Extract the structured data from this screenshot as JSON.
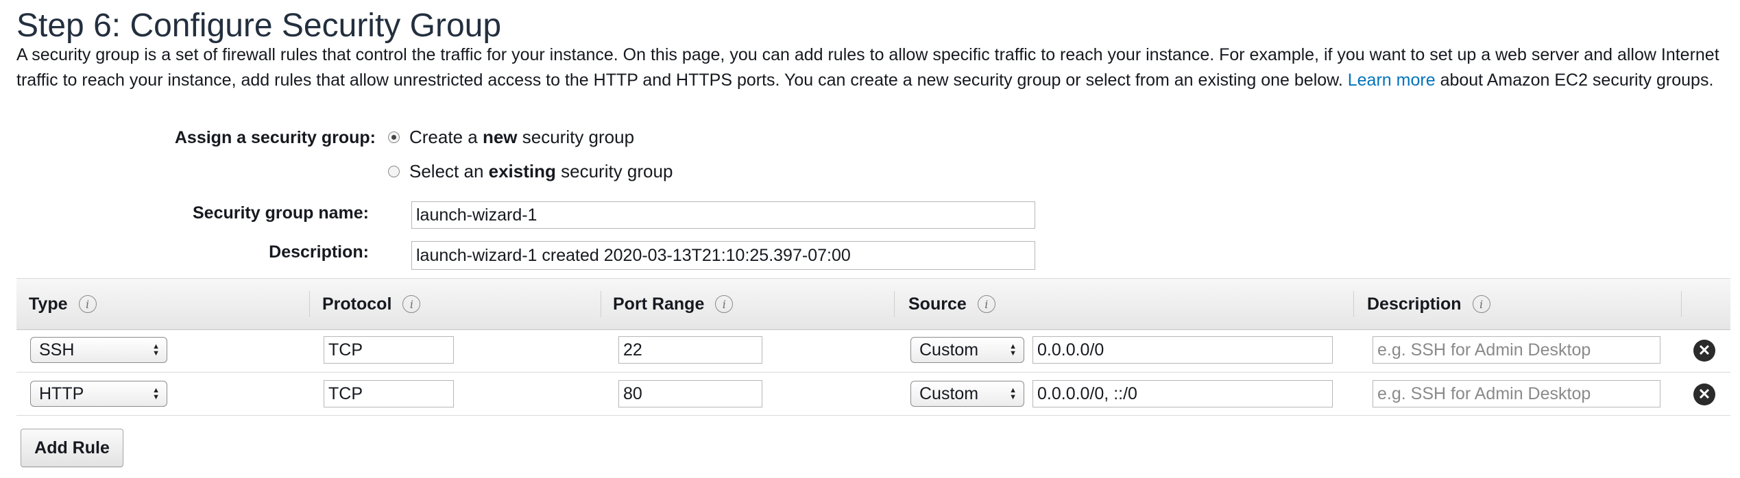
{
  "page": {
    "title": "Step 6: Configure Security Group",
    "intro_text": "A security group is a set of firewall rules that control the traffic for your instance. On this page, you can add rules to allow specific traffic to reach your instance. For example, if you want to set up a web server and allow Internet traffic to reach your instance, add rules that allow unrestricted access to the HTTP and HTTPS ports. You can create a new security group or select from an existing one below.",
    "learn_more_link": "Learn more",
    "intro_suffix": "about Amazon EC2 security groups."
  },
  "assign": {
    "label": "Assign a security group:",
    "option_new": {
      "prefix": "Create a ",
      "bold": "new",
      "suffix": " security group",
      "selected": true
    },
    "option_existing": {
      "prefix": "Select an ",
      "bold": "existing",
      "suffix": " security group",
      "selected": false
    }
  },
  "group": {
    "name_label": "Security group name:",
    "name_value": "launch-wizard-1",
    "description_label": "Description:",
    "description_value": "launch-wizard-1 created 2020-03-13T21:10:25.397-07:00"
  },
  "table": {
    "headers": [
      "Type",
      "Protocol",
      "Port Range",
      "Source",
      "Description"
    ],
    "info_glyph": "i",
    "rows": [
      {
        "type": "SSH",
        "protocol": "TCP",
        "port": "22",
        "source_mode": "Custom",
        "source_cidr": "0.0.0.0/0",
        "description_placeholder": "e.g. SSH for Admin Desktop"
      },
      {
        "type": "HTTP",
        "protocol": "TCP",
        "port": "80",
        "source_mode": "Custom",
        "source_cidr": "0.0.0.0/0, ::/0",
        "description_placeholder": "e.g. SSH for Admin Desktop"
      }
    ],
    "delete_glyph": "✕",
    "select_arrow_up": "▲",
    "select_arrow_down": "▼"
  },
  "actions": {
    "add_rule_label": "Add Rule"
  },
  "colors": {
    "link": "#0073bb",
    "title": "#232f3e",
    "text": "#16191f"
  }
}
